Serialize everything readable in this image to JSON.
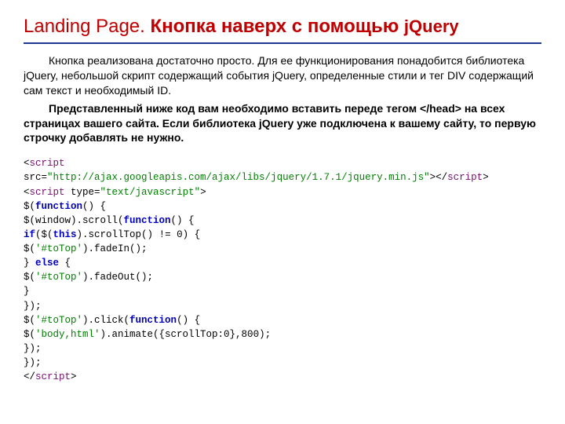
{
  "title": {
    "part1": "Landing Page. ",
    "part2": "Кнопка наверх с помощью ",
    "part3": "jQuery"
  },
  "paragraphs": {
    "p1": "Кнопка реализована достаточно просто. Для ее функционирования понадобится библиотека jQuery, небольшой скрипт содержащий события jQuery, определенные стили и тег DIV содержащий сам текст и необходимый ID.",
    "p2a": "Представленный ниже код вам необходимо вставить переде тегом ",
    "p2tag": "</head>",
    "p2b": " на всех страницах вашего сайта. Если библиотека jQuery уже подключена к вашему сайту, то первую строчку добавлять не нужно."
  },
  "code": {
    "l01a": "<",
    "l01b": "script",
    "l02a": "src=",
    "l02b": "\"http://ajax.googleapis.com/ajax/libs/jquery/1.7.1/jquery.min.js\"",
    "l02c": "></",
    "l02d": "script",
    "l02e": ">",
    "l03a": "<",
    "l03b": "script ",
    "l03c": "type=",
    "l03d": "\"text/javascript\"",
    "l03e": ">",
    "l04a": "$(",
    "l04b": "function",
    "l04c": "() {",
    "l05a": "$(window).scroll(",
    "l05b": "function",
    "l05c": "() {",
    "l06a": "if",
    "l06b": "($(",
    "l06c": "this",
    "l06d": ").scrollTop() != 0) {",
    "l07a": "$(",
    "l07b": "'#toTop'",
    "l07c": ").fadeIn();",
    "l08a": "} ",
    "l08b": "else ",
    "l08c": "{",
    "l09a": "$(",
    "l09b": "'#toTop'",
    "l09c": ").fadeOut();",
    "l10": "}",
    "l11": "});",
    "l12a": "$(",
    "l12b": "'#toTop'",
    "l12c": ").click(",
    "l12d": "function",
    "l12e": "() {",
    "l13a": "$(",
    "l13b": "'body,html'",
    "l13c": ").animate({scrollTop:0},800);",
    "l14": "});",
    "l15": "});",
    "l16a": "</",
    "l16b": "script",
    "l16c": ">"
  }
}
